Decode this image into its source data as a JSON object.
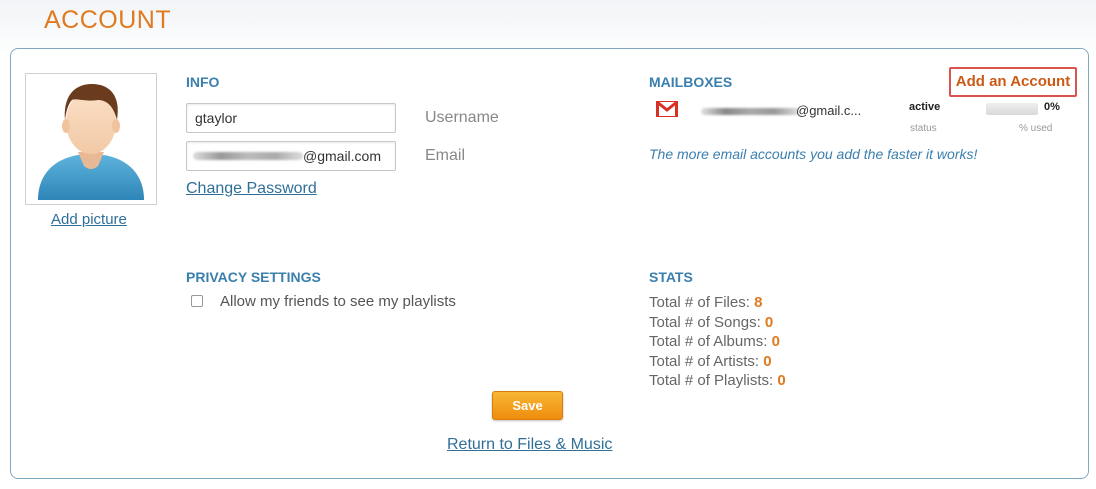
{
  "page": {
    "title": "ACCOUNT"
  },
  "profile": {
    "add_picture_label": "Add picture"
  },
  "info": {
    "title": "INFO",
    "username_value": "gtaylor",
    "username_label": "Username",
    "email_visible_suffix": "@gmail.com",
    "email_label": "Email",
    "change_password_label": "Change Password"
  },
  "privacy": {
    "title": "PRIVACY SETTINGS",
    "playlists_checkbox_label": "Allow my friends to see my playlists",
    "playlists_checked": false
  },
  "mailboxes": {
    "title": "MAILBOXES",
    "add_account_label": "Add an Account",
    "items": [
      {
        "provider_icon": "gmail-icon",
        "email_visible_suffix": "@gmail.c...",
        "status": "active",
        "percent_used": "0%",
        "usage_fraction": 0
      }
    ],
    "status_caption": "status",
    "used_caption": "% used",
    "tagline": "The more email accounts you add the faster it works!"
  },
  "stats": {
    "title": "STATS",
    "rows": [
      {
        "label": "Total # of Files:",
        "value": "8"
      },
      {
        "label": "Total # of Songs:",
        "value": "0"
      },
      {
        "label": "Total # of Albums:",
        "value": "0"
      },
      {
        "label": "Total # of Artists:",
        "value": "0"
      },
      {
        "label": "Total # of Playlists:",
        "value": "0"
      }
    ]
  },
  "actions": {
    "save_label": "Save",
    "return_label": "Return to Files & Music"
  },
  "colors": {
    "accent_orange": "#e07a1f",
    "heading_blue": "#3a7fae",
    "panel_border": "#7fa9c3",
    "highlight_red": "#d9534f"
  }
}
